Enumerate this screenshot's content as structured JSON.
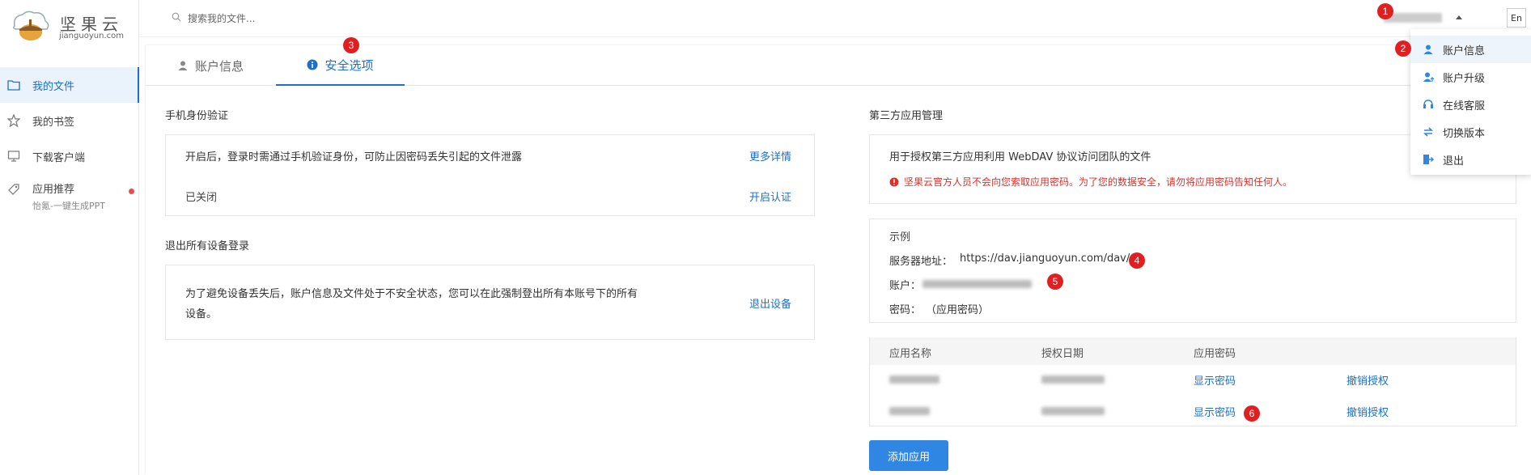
{
  "app": {
    "logo_text": "坚果云",
    "logo_sub": "jianguoyun.com"
  },
  "colors": {
    "accent": "#1d6fc8",
    "primary_button": "#2f86e3",
    "warning": "#d9312b",
    "marker": "#e02020"
  },
  "sidebar": {
    "items": [
      {
        "label": "我的文件",
        "icon": "folder-icon",
        "active": true
      },
      {
        "label": "我的书签",
        "icon": "star-icon",
        "active": false
      },
      {
        "label": "下载客户端",
        "icon": "monitor-icon",
        "active": false
      },
      {
        "label": "应用推荐",
        "sub": "怡氪-一键生成PPT",
        "icon": "tag-icon",
        "active": false,
        "badge": true
      }
    ]
  },
  "topbar": {
    "search_placeholder": "搜索我的文件...",
    "lang": "En"
  },
  "dropdown": {
    "items": [
      {
        "label": "账户信息",
        "icon": "user-icon"
      },
      {
        "label": "账户升级",
        "icon": "user-upgrade-icon"
      },
      {
        "label": "在线客服",
        "icon": "headset-icon"
      },
      {
        "label": "切换版本",
        "icon": "switch-icon"
      },
      {
        "label": "退出",
        "icon": "logout-icon"
      }
    ]
  },
  "tabs": [
    {
      "label": "账户信息",
      "icon": "user-icon",
      "active": false
    },
    {
      "label": "安全选项",
      "icon": "info-icon",
      "active": true
    }
  ],
  "phone_auth": {
    "title": "手机身份验证",
    "desc": "开启后，登录时需通过手机验证身份，可防止因密码丢失引起的文件泄露",
    "more_link": "更多详情",
    "status": "已关闭",
    "enable_link": "开启认证"
  },
  "logout_all": {
    "title": "退出所有设备登录",
    "desc_line1": "为了避免设备丢失后，账户信息及文件处于不安全状态，您可以在此强制登出所有本账号下的所有",
    "desc_line2": "设备。",
    "link": "退出设备"
  },
  "third_party": {
    "title": "第三方应用管理",
    "desc": "用于授权第三方应用利用 WebDAV 协议访问团队的文件",
    "warning": "坚果云官方人员不会向您索取应用密码。为了您的数据安全，请勿将应用密码告知任何人。",
    "example_title": "示例",
    "server_label": "服务器地址：",
    "server_value": "https://dav.jianguoyun.com/dav/",
    "account_label": "账户：",
    "password_label": "密码：",
    "password_value": "（应用密码）",
    "table_headers": [
      "应用名称",
      "授权日期",
      "应用密码"
    ],
    "rows": [
      {
        "show_pwd": "显示密码",
        "revoke": "撤销授权"
      },
      {
        "show_pwd": "显示密码",
        "revoke": "撤销授权"
      }
    ],
    "add_button": "添加应用"
  },
  "markers": [
    "1",
    "2",
    "3",
    "4",
    "5",
    "6"
  ]
}
